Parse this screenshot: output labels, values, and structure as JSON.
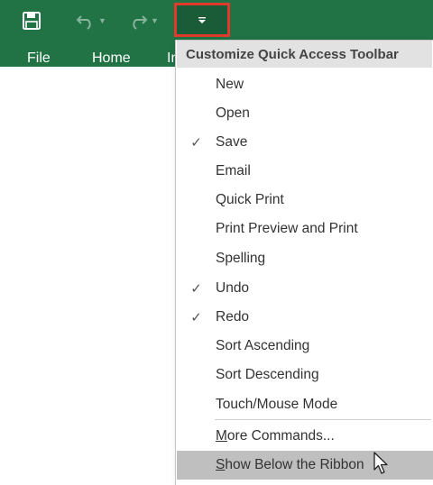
{
  "ribbon": {
    "tabs": [
      "File",
      "Home",
      "In"
    ]
  },
  "qat": {
    "save_icon": "save-icon",
    "undo_icon": "undo-icon",
    "redo_icon": "redo-icon",
    "customize_icon": "customize-qat-dropdown-icon",
    "highlight_color": "#e03a2c",
    "app_color": "#217346"
  },
  "menu": {
    "header": "Customize Quick Access Toolbar",
    "check_glyph": "✓",
    "items": [
      {
        "label": "New",
        "checked": false
      },
      {
        "label": "Open",
        "checked": false
      },
      {
        "label": "Save",
        "checked": true
      },
      {
        "label": "Email",
        "checked": false
      },
      {
        "label": "Quick Print",
        "checked": false
      },
      {
        "label": "Print Preview and Print",
        "checked": false
      },
      {
        "label": "Spelling",
        "checked": false
      },
      {
        "label": "Undo",
        "checked": true
      },
      {
        "label": "Redo",
        "checked": true
      },
      {
        "label": "Sort Ascending",
        "checked": false
      },
      {
        "label": "Sort Descending",
        "checked": false
      },
      {
        "label": "Touch/Mouse Mode",
        "checked": false
      }
    ],
    "more_commands": {
      "accel": "M",
      "rest": "ore Commands..."
    },
    "show_below": {
      "accel": "S",
      "rest": "how Below the Ribbon"
    }
  }
}
